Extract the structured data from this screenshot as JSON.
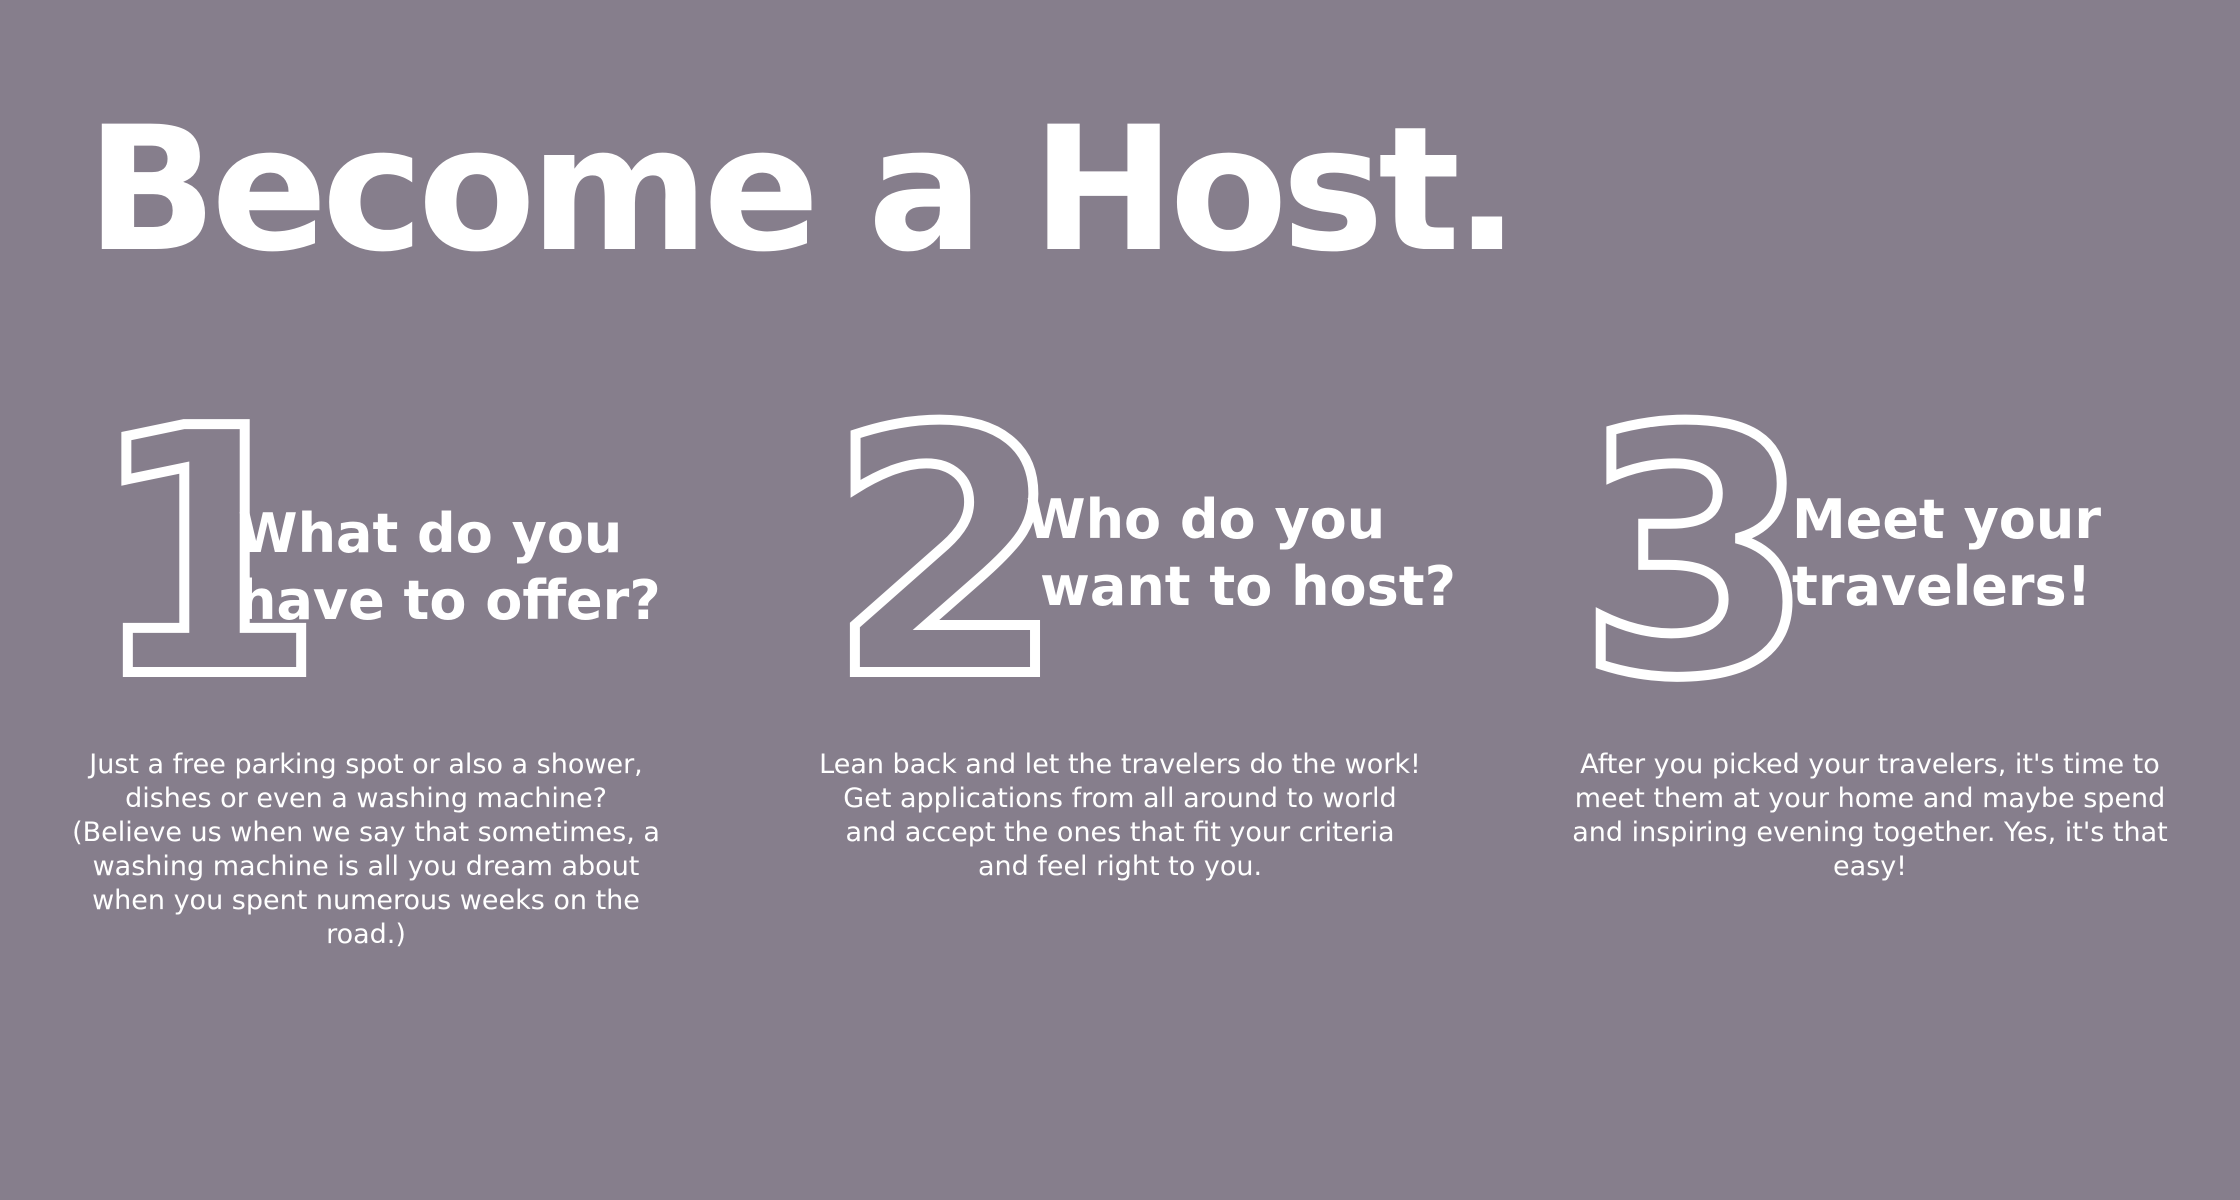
{
  "page": {
    "title": "Become a Host.",
    "background_color": "#867e8c",
    "text_color": "#ffffff"
  },
  "steps": [
    {
      "number": "1",
      "heading_lines": [
        "What do you",
        "have to offer?"
      ],
      "body_lines": [
        "Just a free parking spot or also a shower,",
        "dishes or even a washing machine?",
        "(Believe us when we say that sometimes, a",
        "washing machine is all you dream about",
        "when you spent numerous weeks on the",
        "road.)"
      ]
    },
    {
      "number": "2",
      "heading_lines": [
        "Who do you",
        "want to host?"
      ],
      "body_lines": [
        "Lean back and let the travelers do the work!",
        "Get applications from all around to world",
        "and accept the ones that fit your criteria",
        "and feel right to you."
      ]
    },
    {
      "number": "3",
      "heading_lines": [
        "Meet your",
        "travelers!"
      ],
      "body_lines": [
        "After you picked your travelers, it's time to",
        "meet them at your home and maybe spend",
        "and inspiring evening together. Yes, it's that",
        "easy!"
      ]
    }
  ]
}
